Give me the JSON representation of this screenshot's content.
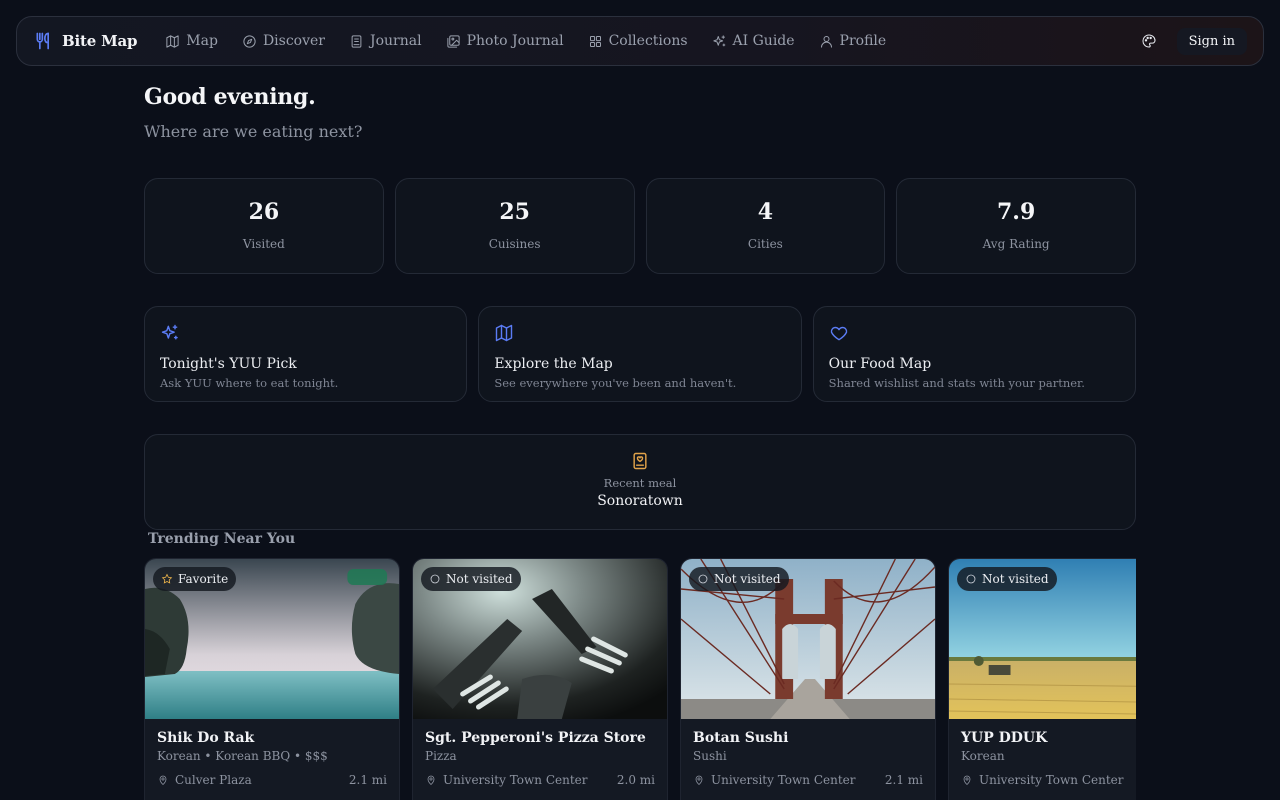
{
  "nav": {
    "brand": "Bite Map",
    "items": [
      {
        "label": "Map",
        "icon": "map-icon"
      },
      {
        "label": "Discover",
        "icon": "compass-icon"
      },
      {
        "label": "Journal",
        "icon": "book-icon"
      },
      {
        "label": "Photo Journal",
        "icon": "image-icon"
      },
      {
        "label": "Collections",
        "icon": "grid-icon"
      },
      {
        "label": "AI Guide",
        "icon": "sparkles-icon"
      },
      {
        "label": "Profile",
        "icon": "user-icon"
      }
    ],
    "theme_icon": "palette-icon",
    "signin_label": "Sign in"
  },
  "header": {
    "greeting": "Good evening.",
    "subtitle": "Where are we eating next?"
  },
  "stats": [
    {
      "value": "26",
      "label": "Visited"
    },
    {
      "value": "25",
      "label": "Cuisines"
    },
    {
      "value": "4",
      "label": "Cities"
    },
    {
      "value": "7.9",
      "label": "Avg Rating"
    }
  ],
  "actions": [
    {
      "title": "Tonight's YUU Pick",
      "desc": "Ask YUU where to eat tonight.",
      "icon": "sparkles-icon"
    },
    {
      "title": "Explore the Map",
      "desc": "See everywhere you've been and haven't.",
      "icon": "map-icon"
    },
    {
      "title": "Our Food Map",
      "desc": "Shared wishlist and stats with your partner.",
      "icon": "heart-icon"
    }
  ],
  "recent": {
    "label": "Recent meal",
    "name": "Sonoratown",
    "icon": "journal-heart-icon"
  },
  "trending": {
    "title": "Trending Near You",
    "cards": [
      {
        "badge": "Favorite",
        "name": "Shik Do Rak",
        "meta": "Korean • Korean BBQ • $$$",
        "location": "Culver Plaza",
        "distance": "2.1 mi"
      },
      {
        "badge": "Not visited",
        "name": "Sgt. Pepperoni's Pizza Store",
        "meta": "Pizza",
        "location": "University Town Center",
        "distance": "2.0 mi"
      },
      {
        "badge": "Not visited",
        "name": "Botan Sushi",
        "meta": "Sushi",
        "location": "University Town Center",
        "distance": "2.1 mi"
      },
      {
        "badge": "Not visited",
        "name": "YUP DDUK",
        "meta": "Korean",
        "location": "University Town Center",
        "distance": ""
      }
    ]
  },
  "colors": {
    "accent": "#5b7cf5",
    "background": "#0b0f19",
    "card": "#0f141d",
    "recent_icon": "#e3a44a",
    "favorite_star": "#f2b84b"
  }
}
